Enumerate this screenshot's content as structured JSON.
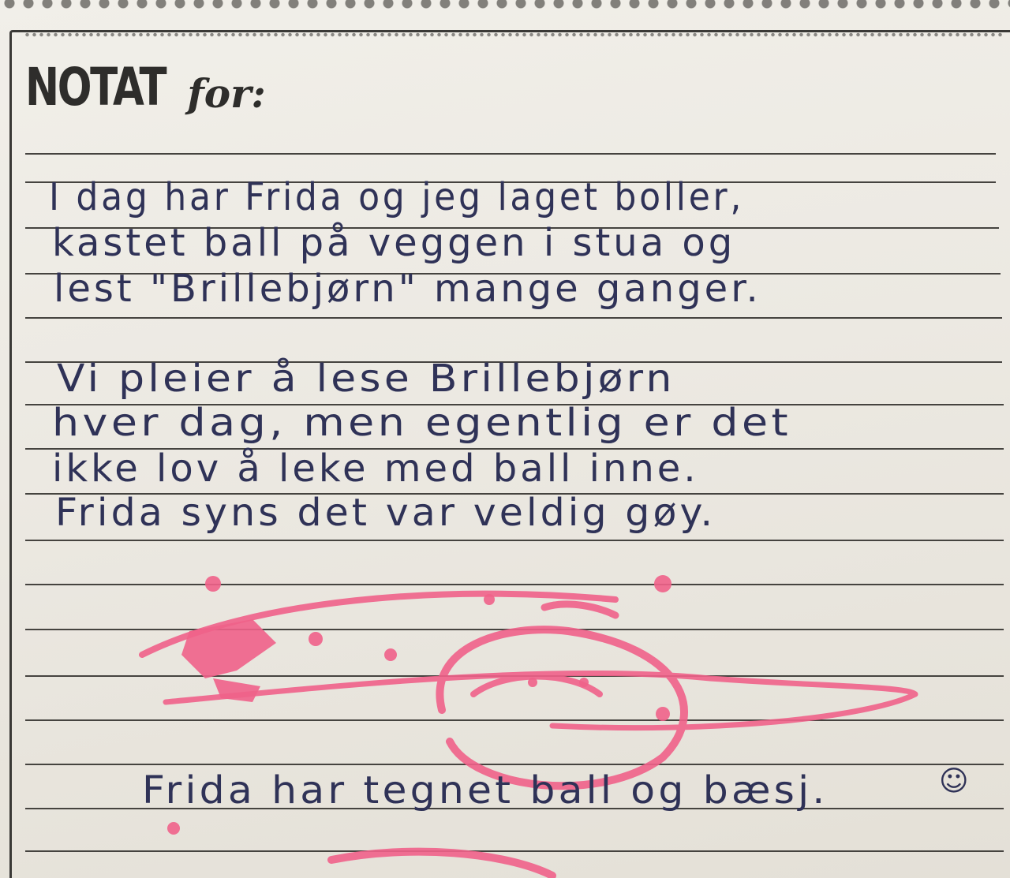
{
  "notepad": {
    "heading_main": "NOTAT",
    "heading_script": "for:"
  },
  "note_lines": [
    "I dag har Frida og jeg laget boller,",
    "kastet ball på veggen i stua og",
    "lest \"Brillebjørn\" mange ganger.",
    "Vi pleier å lese Brillebjørn",
    "hver dag, men egentlig er det",
    "ikke lov å leke med ball inne.",
    "Frida syns det var veldig gøy."
  ],
  "caption": "Frida har tegnet ball og bæsj.",
  "smiley": "☺",
  "colors": {
    "ink": "#2f3257",
    "marker": "#f0628a",
    "paper": "#eeebe4",
    "print": "#2e2d2b"
  }
}
